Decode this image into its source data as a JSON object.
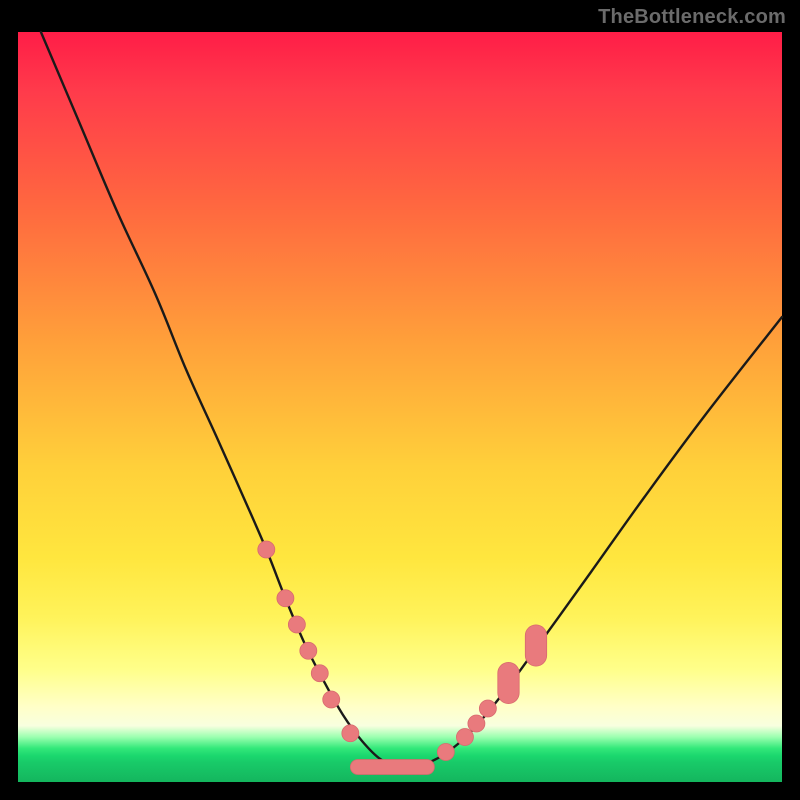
{
  "watermark": {
    "text": "TheBottleneck.com"
  },
  "colors": {
    "curve_stroke": "#1a1a1a",
    "marker_fill": "#e97a7d",
    "marker_stroke": "#d86a6e",
    "background": "#000000"
  },
  "chart_data": {
    "type": "line",
    "title": "",
    "xlabel": "",
    "ylabel": "",
    "xlim": [
      0,
      100
    ],
    "ylim": [
      0,
      100
    ],
    "note": "Axes are unlabeled; values are estimated from pixel positions. y=0 is the bottom (green) edge, y=100 is the top (red) edge.",
    "series": [
      {
        "name": "bottleneck-curve",
        "x": [
          3,
          8,
          13,
          18,
          22,
          26,
          29.5,
          32.5,
          35,
          37.5,
          40,
          42.5,
          45,
          47.5,
          50,
          52.5,
          55,
          57.5,
          60,
          64,
          69,
          75,
          82,
          90,
          100
        ],
        "y": [
          100,
          88,
          76,
          65,
          55,
          46,
          38,
          31,
          24.5,
          18.5,
          13.5,
          9,
          5.5,
          3,
          2,
          2.2,
          3.2,
          5,
          7.5,
          12.5,
          19.5,
          28,
          38,
          49,
          62
        ]
      }
    ],
    "markers": {
      "name": "highlighted-points",
      "note": "Salmon dot/lozenge markers overlaid on the curve; positions estimated.",
      "points": [
        {
          "x": 32.5,
          "y": 31,
          "shape": "dot"
        },
        {
          "x": 35.0,
          "y": 24.5,
          "shape": "dot"
        },
        {
          "x": 36.5,
          "y": 21,
          "shape": "dot"
        },
        {
          "x": 38.0,
          "y": 17.5,
          "shape": "dot"
        },
        {
          "x": 39.5,
          "y": 14.5,
          "shape": "dot"
        },
        {
          "x": 41.0,
          "y": 11,
          "shape": "dot"
        },
        {
          "x": 43.5,
          "y": 6.5,
          "shape": "dot"
        },
        {
          "x": 49.0,
          "y": 2.0,
          "shape": "lozenge",
          "w": 11,
          "h": 2
        },
        {
          "x": 56.0,
          "y": 4.0,
          "shape": "dot"
        },
        {
          "x": 58.5,
          "y": 6.0,
          "shape": "dot"
        },
        {
          "x": 60.0,
          "y": 7.8,
          "shape": "dot"
        },
        {
          "x": 61.5,
          "y": 9.8,
          "shape": "dot"
        },
        {
          "x": 64.2,
          "y": 13.2,
          "shape": "lozenge",
          "w": 2.8,
          "h": 5.5
        },
        {
          "x": 67.8,
          "y": 18.2,
          "shape": "lozenge",
          "w": 2.8,
          "h": 5.5
        }
      ]
    }
  }
}
